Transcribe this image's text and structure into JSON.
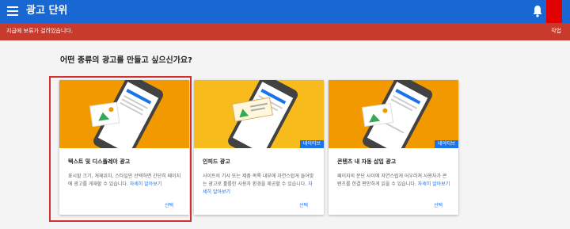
{
  "header": {
    "title": "광고 단위",
    "menu_icon": "menu-icon",
    "bell_icon": "bell-icon"
  },
  "alert": {
    "message": "지급에 보류가 걸려있습니다.",
    "action": "작업"
  },
  "question": "어떤 종류의 광고를 만들고 싶으신가요?",
  "cards": [
    {
      "title": "텍스트 및 디스플레이 광고",
      "desc": "표시할 크기, 게재위치, 스타일만 선택하면 간단히 페이지에 광고를 게재할 수 있습니다. ",
      "learn_more": "자세히 알아보기",
      "select": "선택",
      "badge": "",
      "bg": "#f29900"
    },
    {
      "title": "인피드 광고",
      "desc": "사이트의 기사 또는 제품 목록 내부에 자연스럽게 들어맞는 광고로 훌륭한 사용자 환경을 제공할 수 있습니다. ",
      "learn_more": "자세히 알아보기",
      "select": "선택",
      "badge": "네이티브",
      "bg": "#f8bb1c"
    },
    {
      "title": "콘텐츠 내 자동 삽입 광고",
      "desc": "페이지의 문단 사이에 자연스럽게 어우러져 사용자가 콘텐츠를 한결 편안하게 읽을 수 있습니다. ",
      "learn_more": "자세히 알아보기",
      "select": "선택",
      "badge": "네이티브",
      "bg": "#f29900"
    }
  ],
  "colors": {
    "header": "#1967d2",
    "alert": "#c83a2c",
    "accent": "#1a73e8",
    "highlight": "#d32f2f"
  }
}
